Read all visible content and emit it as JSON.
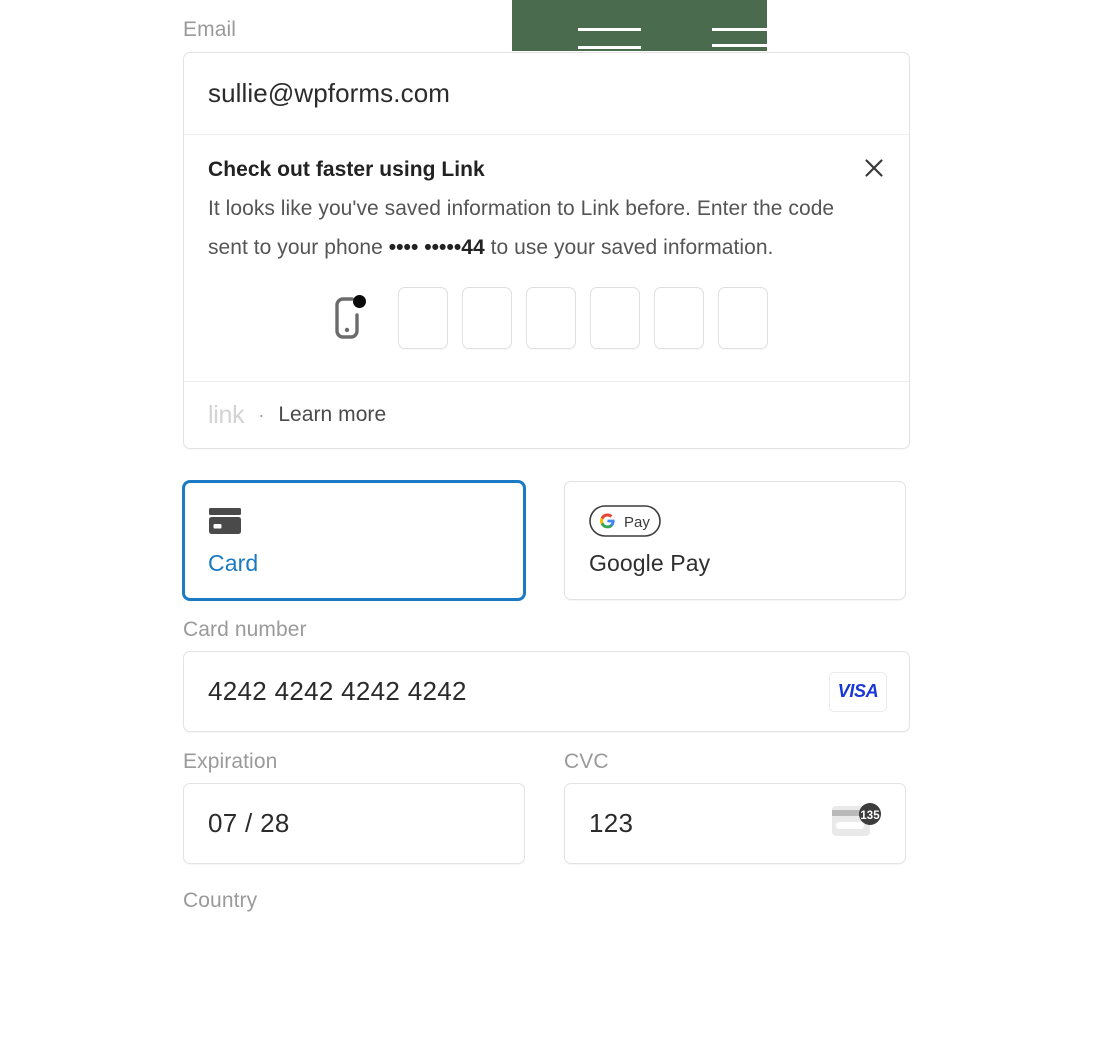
{
  "overlay_banner": {
    "name": "cut-off-dark-banner",
    "color": "#4a6b4d"
  },
  "email": {
    "label": "Email",
    "value": "sullie@wpforms.com",
    "placeholder": "Email"
  },
  "link_promo": {
    "title": "Check out faster using Link",
    "body_line1": "It looks like you've saved information to Link before.",
    "body_line2_pre": "Enter the code sent to your phone ",
    "body_masked": "•••• •••••",
    "body_last4": "44",
    "body_line2_post": " to use your saved information.",
    "close_label": "×",
    "otp_boxes": [
      "",
      "",
      "",
      "",
      "",
      ""
    ],
    "otp_count": 6,
    "footer_logo": "link",
    "footer_separator": "·",
    "footer_link": "Learn more"
  },
  "payment_methods": {
    "tabs": [
      {
        "id": "card",
        "label": "Card",
        "icon": "credit-card-icon",
        "selected": true
      },
      {
        "id": "google_pay",
        "label": "Google Pay",
        "icon": "google-pay-icon",
        "selected": false
      }
    ],
    "selected_color": "#1a7ac4"
  },
  "card_form": {
    "card_number": {
      "label": "Card number",
      "value": "4242 4242 4242 4242",
      "placeholder": "1234 1234 1234 1234",
      "brand": "VISA",
      "brand_color": "#1a36d8"
    },
    "expiration": {
      "label": "Expiration",
      "value": "07 / 28",
      "placeholder": "MM / YY"
    },
    "cvc": {
      "label": "CVC",
      "value": "123",
      "placeholder": "CVC",
      "icon_digits": "135"
    },
    "country": {
      "label": "Country"
    }
  }
}
